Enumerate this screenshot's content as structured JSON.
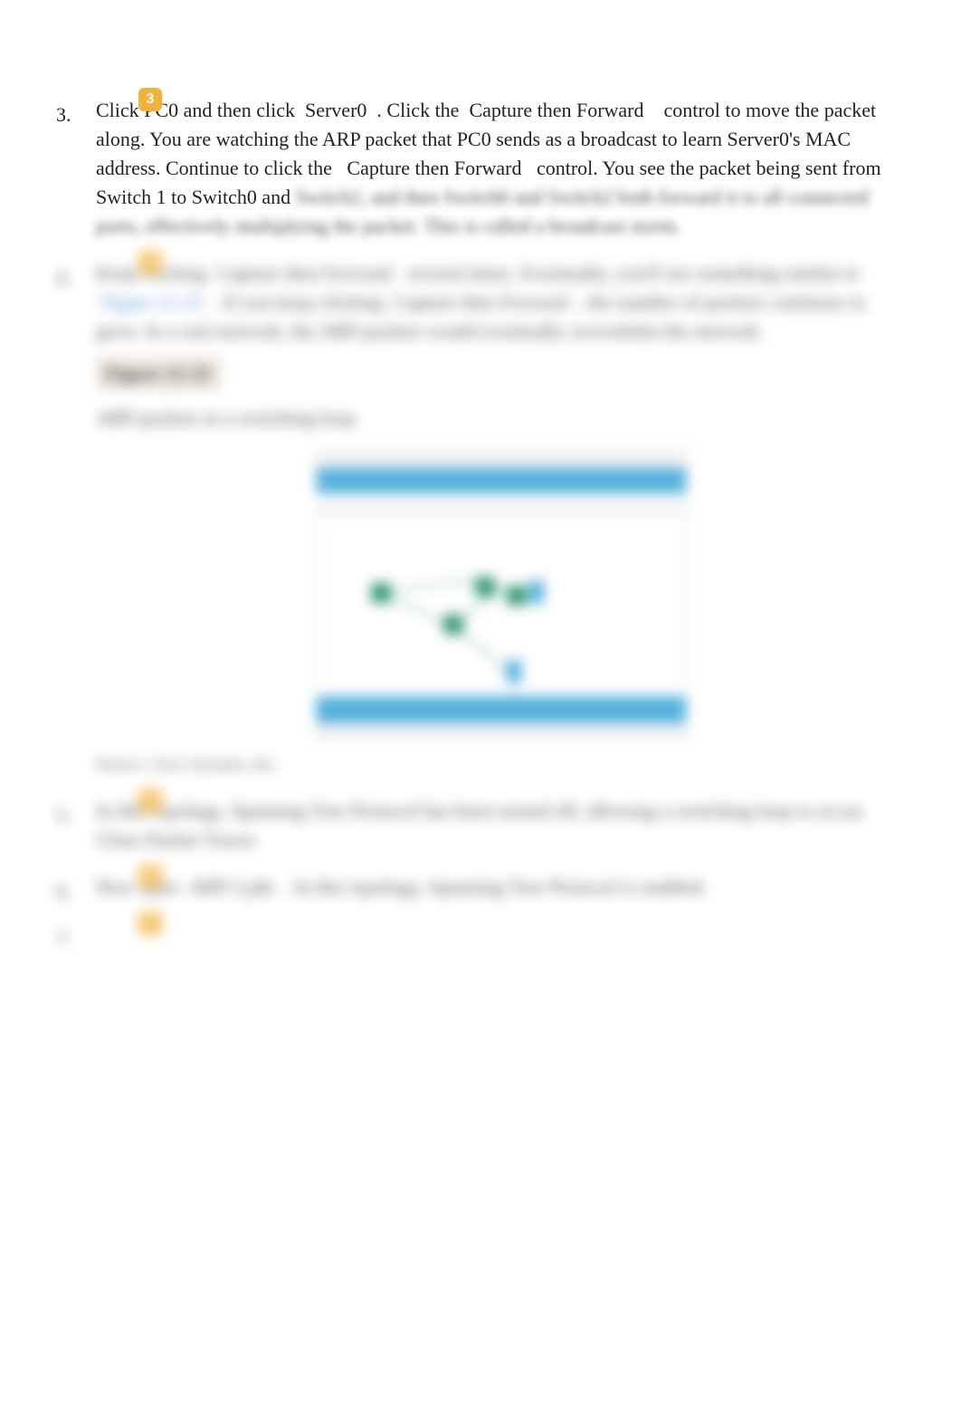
{
  "steps": {
    "s3": {
      "num": "3.",
      "badge": "3",
      "text_a": "Click",
      "text_b": "PC0 and then click",
      "text_c": "Server0",
      "text_d": ". Click the",
      "text_e": "Capture then Forward",
      "text_f": "control to move the packet along. You are watching the ARP packet that PC0 sends as a broadcast to learn Server0's MAC address. Continue to click the",
      "text_g": "Capture then Forward",
      "text_h": "control. You see the packet being sent from Switch 1 to Switch0 and",
      "hidden_tail": "Switch2, and then Switch0 and Switch2 both forward it to all connected ports, effectively multiplying the packet. This is called a broadcast storm."
    },
    "s4": {
      "num": "4.",
      "badge": "4",
      "line1_a": "Keep clicking",
      "line1_b": "Capture then Forward",
      "line1_c": "several times. Eventually, you'll see",
      "line2_a": "something similar to",
      "figref": "Figure 11-25",
      "line2_b": ". If you keep clicking",
      "line2_c": "Capture then Forward",
      "line2_d": ", the",
      "line3": "number of packets continues to grow. In a real network, the ARP packets would eventually overwhelm the network.",
      "figlabel": "Figure 11-25",
      "figcaption": "ARP packets in a switching loop",
      "credit": "Source: Cisco Systems, Inc."
    },
    "s5": {
      "num": "5.",
      "badge": "5",
      "text": "In this topology, Spanning Tree Protocol has been turned off, allowing a switching loop to occur. Close Packet Tracer."
    },
    "s6": {
      "num": "6.",
      "badge": "6",
      "text_a": "Now open",
      "text_b": "ARP-2.pkt",
      "text_c": ". In this topology, Spanning Tree Protocol is enabled."
    },
    "s7": {
      "num": "7.",
      "badge": "7"
    }
  }
}
